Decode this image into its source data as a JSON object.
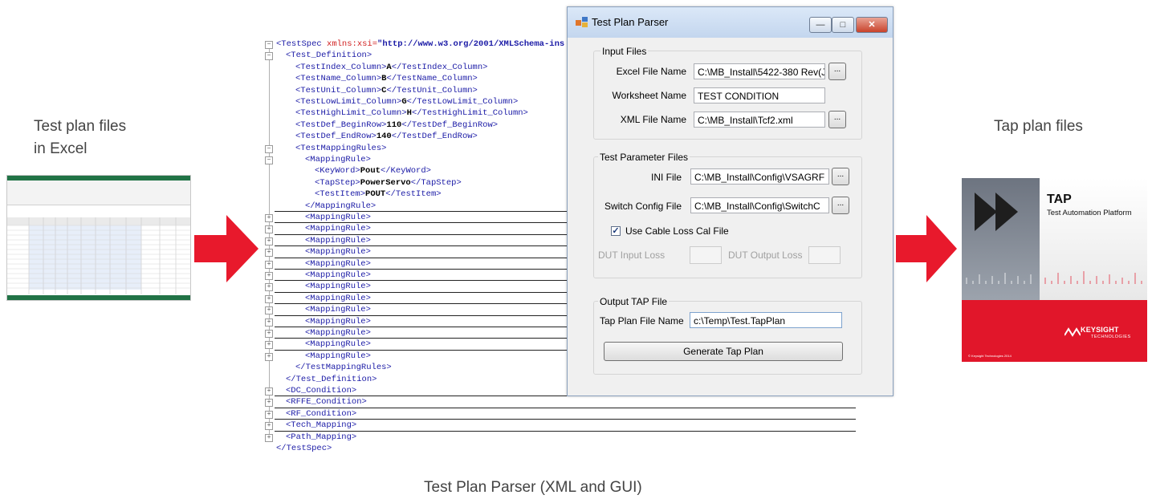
{
  "captions": {
    "excel_line1": "Test plan files",
    "excel_line2": "in Excel",
    "tap": "Tap plan files",
    "bottom": "Test Plan Parser (XML and GUI)"
  },
  "colors": {
    "arrow": "#e8192c",
    "tap_red": "#e1162a"
  },
  "xml": {
    "root_open": "<TestSpec",
    "root_attr": " xmlns:xsi=",
    "root_str": "\"http://www.w3.org/2001/XMLSchema-ins",
    "lines": [
      {
        "open": "<Test_Definition>"
      },
      {
        "open": "<TestIndex_Column>",
        "val": "A",
        "close": "</TestIndex_Column>"
      },
      {
        "open": "<TestName_Column>",
        "val": "B",
        "close": "</TestName_Column>"
      },
      {
        "open": "<TestUnit_Column>",
        "val": "C",
        "close": "</TestUnit_Column>"
      },
      {
        "open": "<TestLowLimit_Column>",
        "val": "G",
        "close": "</TestLowLimit_Column>"
      },
      {
        "open": "<TestHighLimit_Column>",
        "val": "H",
        "close": "</TestHighLimit_Column>"
      },
      {
        "open": "<TestDef_BeginRow>",
        "val": "110",
        "close": "</TestDef_BeginRow>"
      },
      {
        "open": "<TestDef_EndRow>",
        "val": "140",
        "close": "</TestDef_EndRow>"
      },
      {
        "open": "<TestMappingRules>"
      },
      {
        "open": "<MappingRule>"
      },
      {
        "open": "<KeyWord>",
        "val": "Pout",
        "close": "</KeyWord>"
      },
      {
        "open": "<TapStep>",
        "val": "PowerServo",
        "close": "</TapStep>"
      },
      {
        "open": "<TestItem>",
        "val": "POUT",
        "close": "</TestItem>"
      },
      {
        "open": "</MappingRule>"
      },
      {
        "open": "<MappingRule>"
      },
      {
        "open": "<MappingRule>"
      },
      {
        "open": "<MappingRule>"
      },
      {
        "open": "<MappingRule>"
      },
      {
        "open": "<MappingRule>"
      },
      {
        "open": "<MappingRule>"
      },
      {
        "open": "<MappingRule>"
      },
      {
        "open": "<MappingRule>"
      },
      {
        "open": "<MappingRule>"
      },
      {
        "open": "<MappingRule>"
      },
      {
        "open": "<MappingRule>"
      },
      {
        "open": "<MappingRule>"
      },
      {
        "open": "<MappingRule>"
      },
      {
        "open": "</TestMappingRules>"
      },
      {
        "open": "</Test_Definition>"
      },
      {
        "open": "<DC_Condition>"
      },
      {
        "open": "<RFFE_Condition>"
      },
      {
        "open": "<RF_Condition>"
      },
      {
        "open": "<Tech_Mapping>"
      },
      {
        "open": "<Path_Mapping>"
      },
      {
        "open": "</TestSpec>"
      }
    ]
  },
  "dialog": {
    "title": "Test Plan Parser",
    "input_files_group": "Input Files",
    "excel_label": "Excel File Name",
    "excel_value": "C:\\MB_Install\\5422-380 Rev(J",
    "worksheet_label": "Worksheet Name",
    "worksheet_value": "TEST CONDITION",
    "xml_label": "XML File Name",
    "xml_value": "C:\\MB_Install\\Tcf2.xml",
    "param_group": "Test Parameter Files",
    "ini_label": "INI File",
    "ini_value": "C:\\MB_Install\\Config\\VSAGRF",
    "switch_label": "Switch Config File",
    "switch_value": "C:\\MB_Install\\Config\\SwitchC",
    "cable_check_label": "Use Cable Loss Cal File",
    "cable_checked": true,
    "dut_input_label": "DUT Input Loss",
    "dut_output_label": "DUT Output Loss",
    "output_group": "Output TAP File",
    "tap_label": "Tap Plan File Name",
    "tap_value": "c:\\Temp\\Test.TapPlan",
    "generate_button": "Generate Tap Plan",
    "browse_label": "..."
  },
  "tap_splash": {
    "title": "TAP",
    "subtitle": "Test Automation Platform",
    "brand": "KEYSIGHT",
    "brand_sub": "TECHNOLOGIES",
    "copyright": "© Keysight Technologies 2014"
  }
}
